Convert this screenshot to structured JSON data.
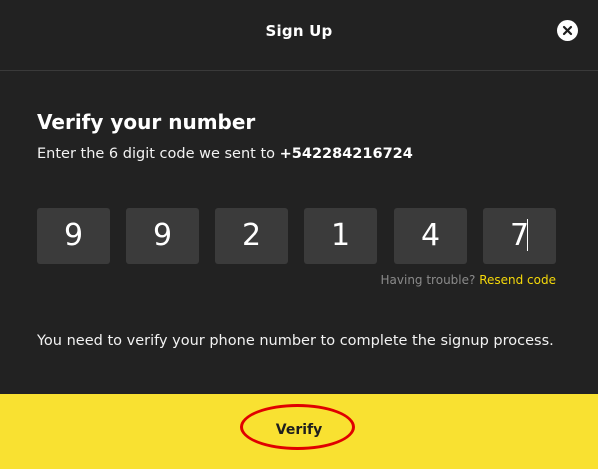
{
  "header": {
    "title": "Sign Up",
    "close_icon": "close-icon"
  },
  "main": {
    "heading": "Verify your number",
    "subtext_prefix": "Enter the 6 digit code we sent to ",
    "phone": "+542284216724",
    "code_digits": [
      "9",
      "9",
      "2",
      "1",
      "4",
      "7"
    ],
    "trouble_text": "Having trouble?",
    "resend_label": "Resend code",
    "info_text": "You need to verify your phone number to complete the signup process."
  },
  "footer": {
    "verify_label": "Verify"
  },
  "colors": {
    "background": "#222222",
    "digit_box": "#3b3b3b",
    "accent": "#f9e131",
    "link": "#f5d90a",
    "annotation": "#e00000"
  }
}
